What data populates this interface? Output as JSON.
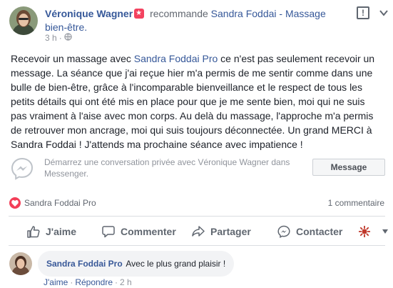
{
  "post": {
    "author": "Véronique Wagner",
    "verb": "recommande",
    "page_name_line1": "Sandra Foddai - Massage",
    "page_name_line2": "bien-être.",
    "time": "3 h",
    "body_part1": "Recevoir un massage avec ",
    "body_link": "Sandra Foddai Pro",
    "body_part2": " ce n'est pas seulement recevoir un message. La séance que j'ai reçue hier m'a permis de me sentir comme dans une bulle de bien-être, grâce à l'incomparable bienveillance et le respect de tous les petits détails qui ont été mis en place pour que je me sente bien, moi qui ne suis pas vraiment à l'aise avec mon corps. Au delà du massage, l'approche m'a permis de retrouver mon ancrage, moi qui suis toujours déconnectée. Un grand MERCI à Sandra Foddai ! J'attends ma prochaine séance avec impatience !"
  },
  "messenger": {
    "prompt": "Démarrez une conversation privée avec Véronique Wagner dans Messenger.",
    "button_label": "Message"
  },
  "reactions": {
    "names": "Sandra Foddai Pro",
    "comment_count": "1 commentaire"
  },
  "actions": {
    "like": "J'aime",
    "comment": "Commenter",
    "share": "Partager",
    "contact": "Contacter"
  },
  "comment": {
    "author": "Sandra Foddai Pro",
    "text": "Avec le plus grand plaisir !",
    "like": "J'aime",
    "reply": "Répondre",
    "time": "2 h"
  },
  "colors": {
    "link": "#365899",
    "heart": "#f33e58",
    "recommend_badge": "#f3425f"
  }
}
